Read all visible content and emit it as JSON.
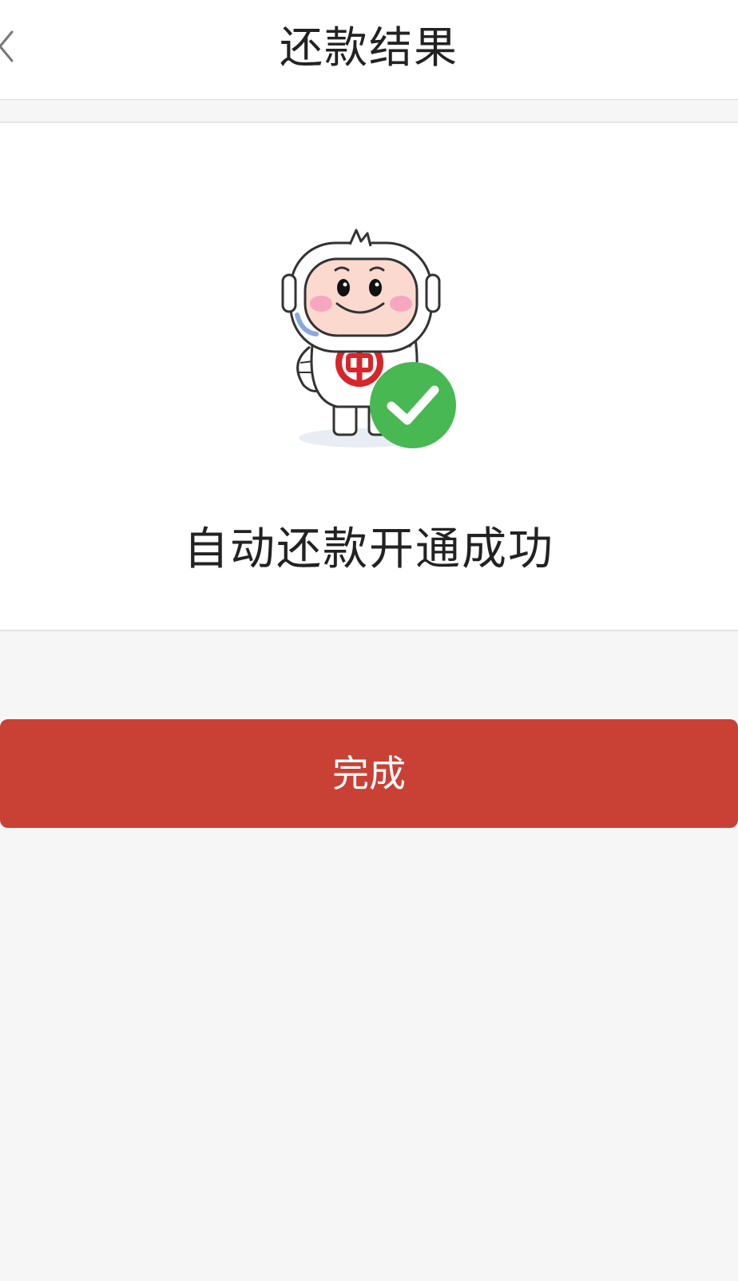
{
  "header": {
    "title": "还款结果",
    "back_icon": "chevron-left-icon"
  },
  "result": {
    "illustration": "mascot-success-illustration",
    "status_icon": "check-circle-icon",
    "message": "自动还款开通成功"
  },
  "actions": {
    "done_label": "完成"
  },
  "colors": {
    "accent": "#c94035",
    "success": "#48b852",
    "logo_red": "#d7262b",
    "background": "#f6f6f6"
  }
}
